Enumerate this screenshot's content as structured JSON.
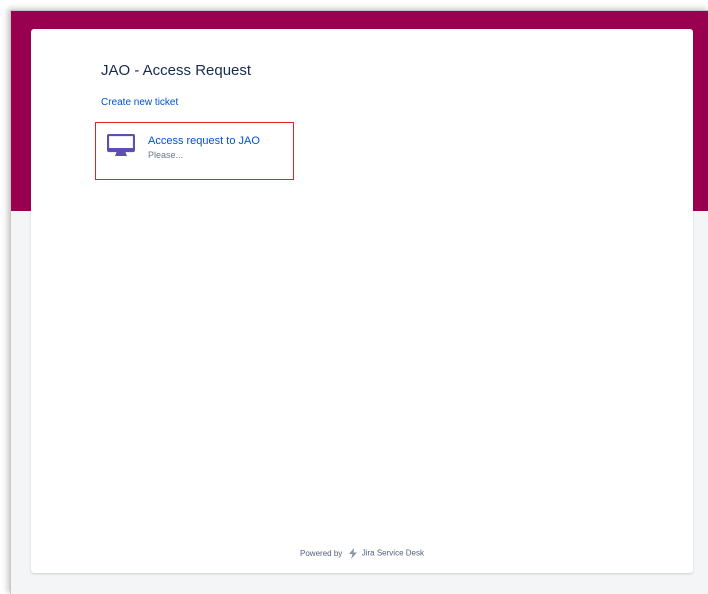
{
  "colors": {
    "banner": "#990050",
    "background": "#f4f5f7",
    "card": "#ffffff",
    "link": "#0052cc",
    "highlight_box": "#e02424",
    "icon": "#5e4db2"
  },
  "portal": {
    "title": "JAO - Access Request",
    "create_label": "Create new ticket"
  },
  "request_types": [
    {
      "icon": "monitor-icon",
      "name": "Access request to JAO",
      "description": "Please..."
    }
  ],
  "footer": {
    "powered_by": "Powered by",
    "product_icon": "jira-bolt-icon",
    "product_name": "Jira Service Desk"
  }
}
